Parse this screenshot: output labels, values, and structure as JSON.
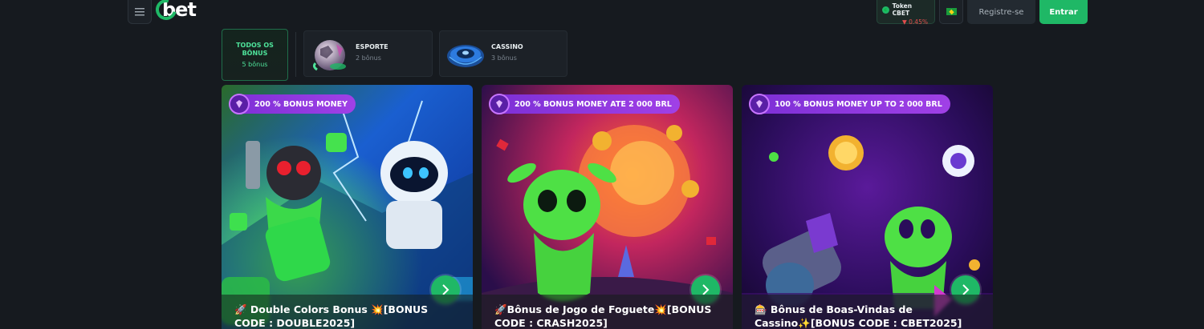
{
  "header": {
    "logo_text": "bet",
    "token": {
      "label": "Token CBET",
      "change": "▼ 0.45%"
    },
    "register_label": "Registre-se",
    "login_label": "Entrar"
  },
  "filters": {
    "all": {
      "label": "TODOS OS BÔNUS",
      "count": "5 bônus"
    },
    "sport": {
      "label": "ESPORTE",
      "count": "2 bônus"
    },
    "casino": {
      "label": "CASSINO",
      "count": "3 bônus"
    }
  },
  "cards": [
    {
      "badge": "200 % BONUS MONEY",
      "title": "🚀 Double Colors Bonus 💥[BONUS CODE : DOUBLE2025]"
    },
    {
      "badge": "200 % BONUS MONEY ATE 2 000 BRL",
      "title": "🚀Bônus de Jogo de Foguete💥[BONUS CODE : CRASH2025]"
    },
    {
      "badge": "100 % BONUS MONEY UP TO 2 000 BRL",
      "title": "🎰 Bônus de Boas-Vindas de Cassino✨[BONUS CODE : CBET2025]"
    }
  ],
  "colors": {
    "accent": "#1fb866",
    "badge": "#8a35dd",
    "background": "#161a1f"
  }
}
